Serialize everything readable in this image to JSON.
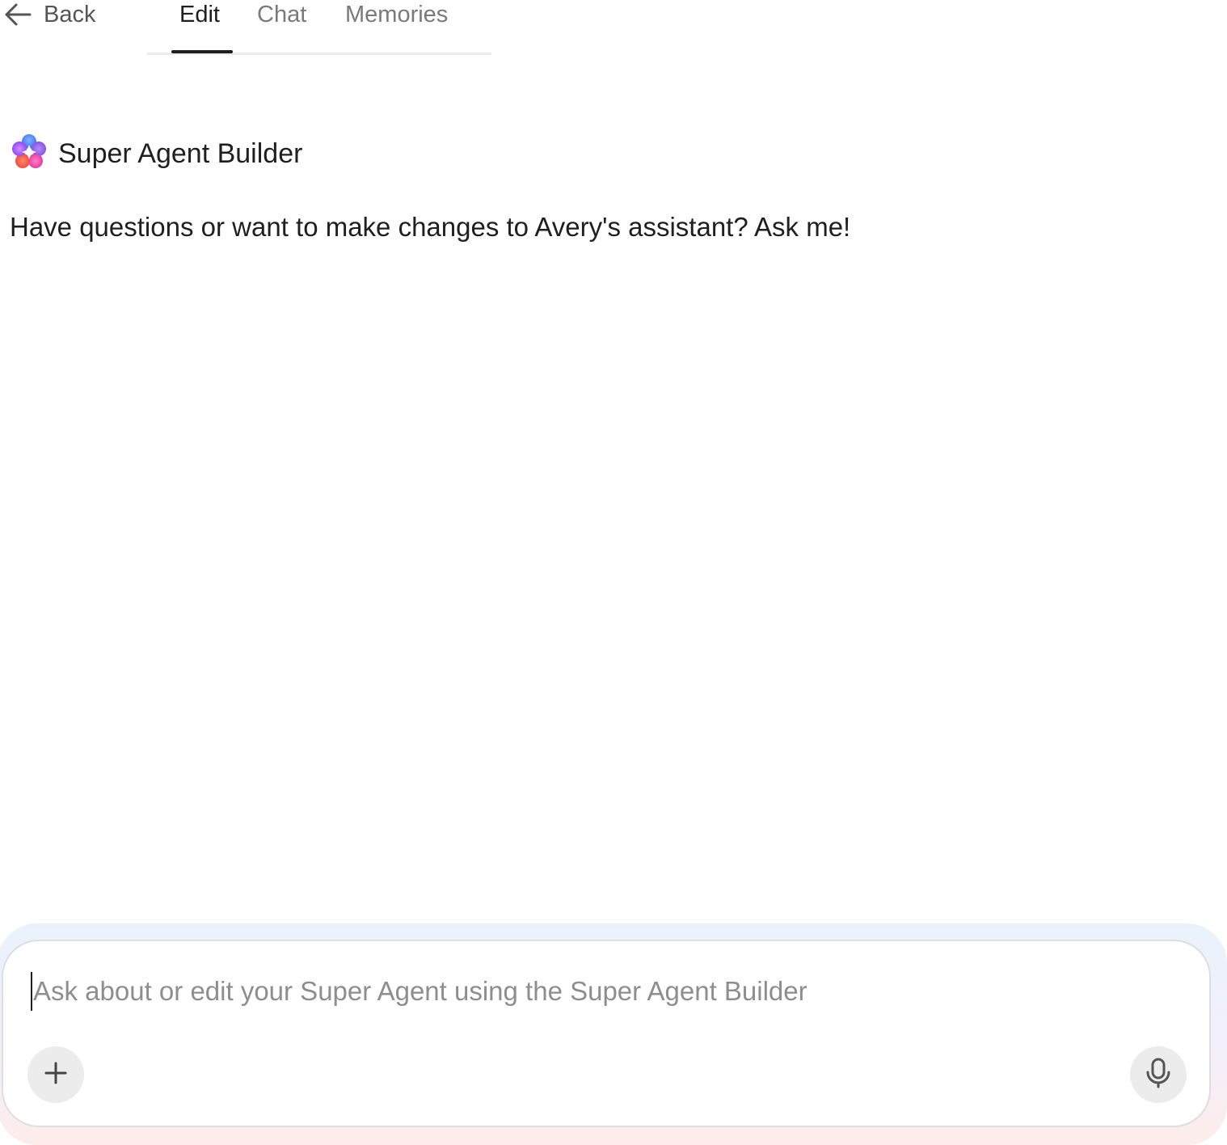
{
  "nav": {
    "back_label": "Back",
    "tabs": [
      {
        "label": "Edit",
        "active": true
      },
      {
        "label": "Chat",
        "active": false
      },
      {
        "label": "Memories",
        "active": false
      }
    ]
  },
  "agent": {
    "name": "Super Agent Builder",
    "icon": "super-agent-flower-icon",
    "intro_message": "Have questions or want to make changes to Avery's assistant? Ask me!"
  },
  "composer": {
    "value": "",
    "placeholder": "Ask about or edit your Super Agent using the Super Agent Builder",
    "add_icon": "plus-icon",
    "mic_icon": "microphone-icon"
  },
  "colors": {
    "text_primary": "#1f1f1f",
    "text_muted": "#7a7a7a",
    "active_tab_underline": "#1f1f1f",
    "composer_glow_top": "#e9f2fc",
    "composer_glow_bottom": "#fdeceb"
  }
}
